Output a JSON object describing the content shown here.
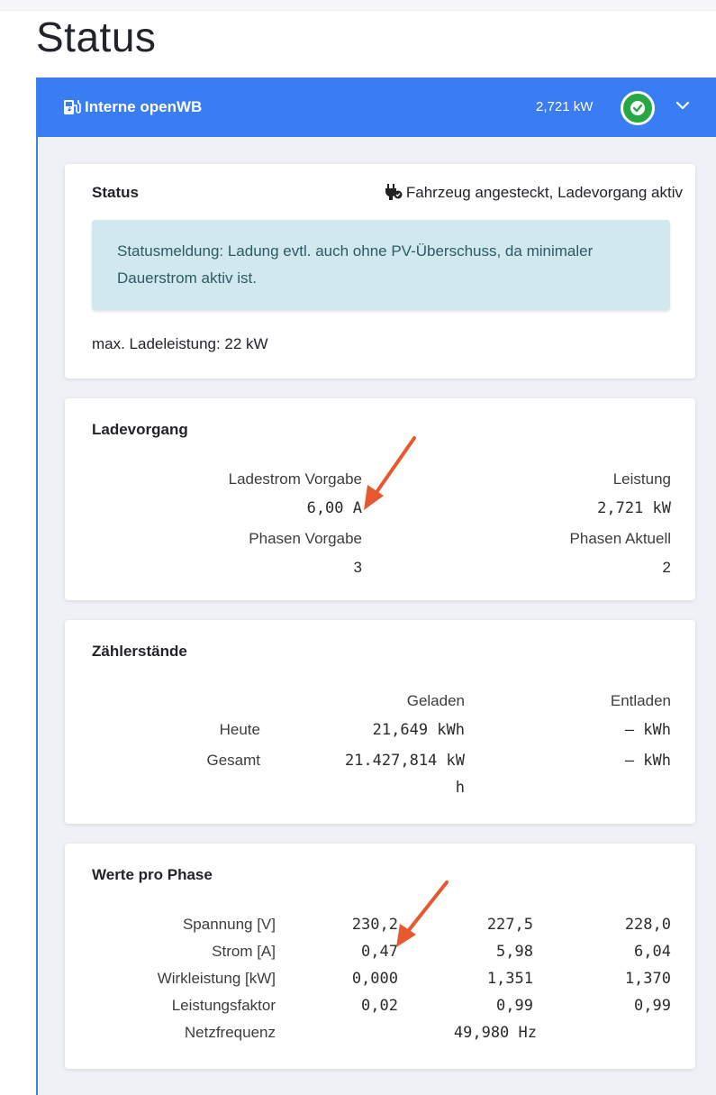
{
  "page": {
    "title": "Status"
  },
  "header": {
    "title": "Interne openWB",
    "power": "2,721 kW",
    "icon": "charging-station-icon",
    "status_icon": "check-circle-icon",
    "toggle_icon": "chevron-down-icon",
    "accent_color": "#3a7cf2",
    "status_color": "#28a745"
  },
  "status_card": {
    "title": "Status",
    "state": "Fahrzeug angesteckt, Ladevorgang aktiv",
    "state_icon": "plug-icon",
    "message": "Statusmeldung: Ladung evtl. auch ohne PV-Überschuss, da minimaler Dauerstrom aktiv ist.",
    "max_power": "max. Ladeleistung: 22 kW"
  },
  "charging_card": {
    "title": "Ladevorgang",
    "current_setpoint_label": "Ladestrom Vorgabe",
    "current_setpoint_value": "6,00 A",
    "power_label": "Leistung",
    "power_value": "2,721 kW",
    "phases_setpoint_label": "Phasen Vorgabe",
    "phases_setpoint_value": "3",
    "phases_actual_label": "Phasen Aktuell",
    "phases_actual_value": "2"
  },
  "meter_card": {
    "title": "Zählerstände",
    "col_charged": "Geladen",
    "col_discharged": "Entladen",
    "rows": [
      {
        "label": "Heute",
        "charged_line1": "21,649 kWh",
        "charged_line2": "",
        "discharged": "– kWh"
      },
      {
        "label": "Gesamt",
        "charged_line1": "21.427,814 kW",
        "charged_line2": "h",
        "discharged": "– kWh"
      }
    ]
  },
  "phase_card": {
    "title": "Werte pro Phase",
    "rows": [
      {
        "label": "Spannung [V]",
        "values": [
          "230,2",
          "227,5",
          "228,0"
        ]
      },
      {
        "label": "Strom [A]",
        "values": [
          "0,47",
          "5,98",
          "6,04"
        ]
      },
      {
        "label": "Wirkleistung [kW]",
        "values": [
          "0,000",
          "1,351",
          "1,370"
        ]
      },
      {
        "label": "Leistungsfaktor",
        "values": [
          "0,02",
          "0,99",
          "0,99"
        ]
      }
    ],
    "frequency_label": "Netzfrequenz",
    "frequency_value": "49,980 Hz"
  },
  "annotations": {
    "arrow_color": "#e8582f"
  }
}
